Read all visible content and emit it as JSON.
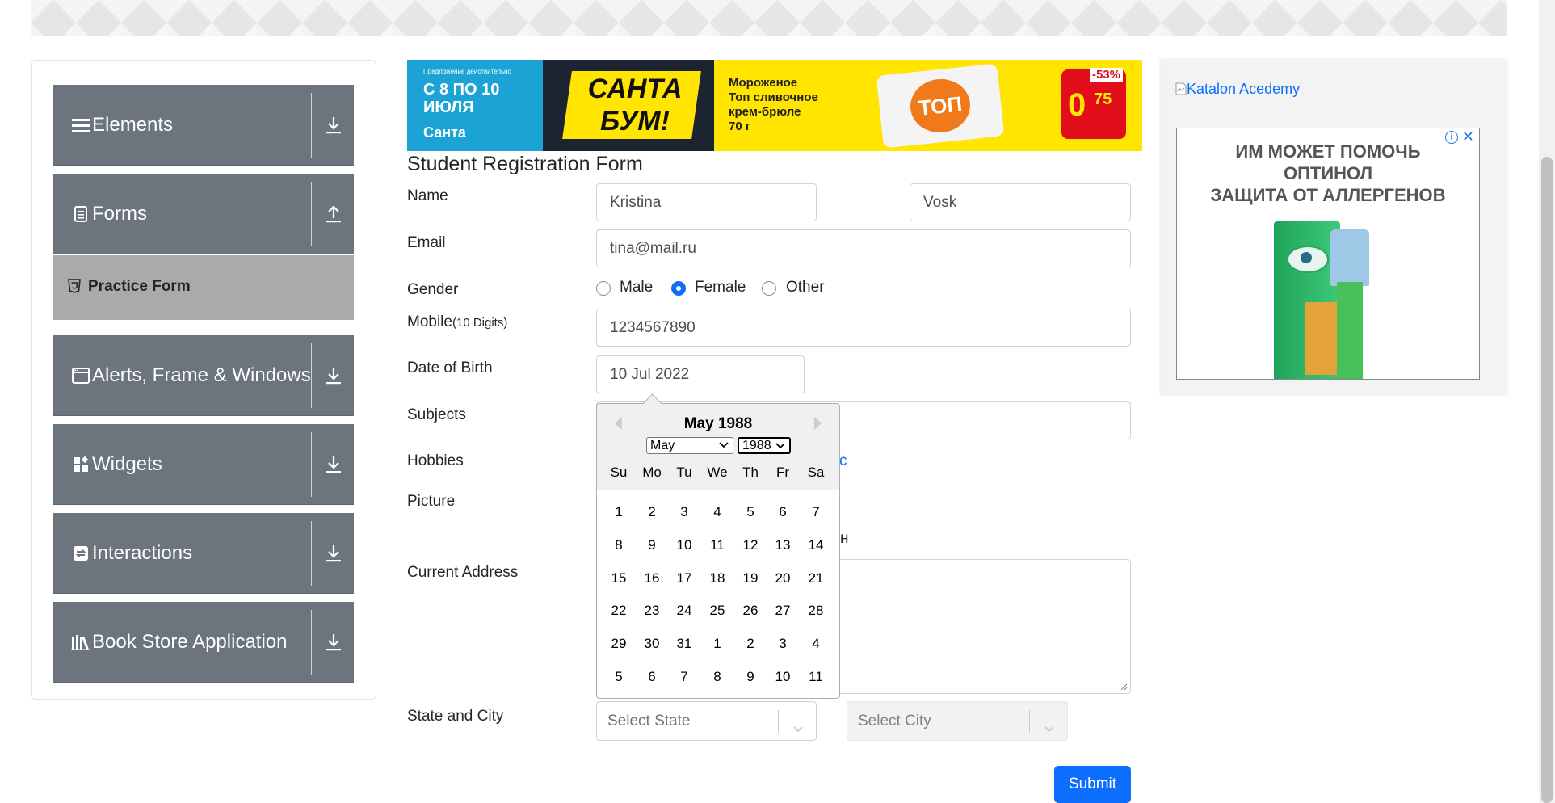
{
  "nav": {
    "groups": [
      {
        "label": "Elements",
        "icon": "hamburger-icon",
        "arrow": "download-arrow-icon"
      },
      {
        "label": "Forms",
        "icon": "document-icon",
        "arrow": "upload-arrow-icon"
      },
      {
        "label": "Alerts, Frame & Windows",
        "icon": "window-icon",
        "arrow": "download-arrow-icon"
      },
      {
        "label": "Widgets",
        "icon": "widgets-icon",
        "arrow": "download-arrow-icon"
      },
      {
        "label": "Interactions",
        "icon": "interactions-icon",
        "arrow": "download-arrow-icon"
      },
      {
        "label": "Book Store Application",
        "icon": "books-icon",
        "arrow": "download-arrow-icon"
      }
    ],
    "active_item": {
      "label": "Practice Form",
      "icon": "html5-icon"
    }
  },
  "ad_banner": {
    "left_text": [
      "Предложение действительно",
      "С 8 ПО 10",
      "ИЮЛЯ",
      "Санта"
    ],
    "brand": "САНТА БУМ!",
    "product_text": [
      "Мороженое",
      "Топ сливочное",
      "крем-брюле",
      "70 г"
    ],
    "product_name": "ТОП",
    "discount": "-53%",
    "price_main": "0",
    "price_cents": "75"
  },
  "form": {
    "title": "Student Registration Form",
    "labels": {
      "name": "Name",
      "email": "Email",
      "gender": "Gender",
      "mobile": "Mobile",
      "mobile_hint": "(10 Digits)",
      "dob": "Date of Birth",
      "subjects": "Subjects",
      "hobbies": "Hobbies",
      "picture": "Picture",
      "address": "Current Address",
      "state_city": "State and City"
    },
    "first_name": "Kristina",
    "last_name": "Vosk",
    "email": "tina@mail.ru",
    "gender_options": [
      "Male",
      "Female",
      "Other"
    ],
    "gender_selected": "Female",
    "mobile": "1234567890",
    "dob": "10 Jul 2022",
    "hobbies_fragment": "c",
    "picture_fragment": "н",
    "state_placeholder": "Select State",
    "city_placeholder": "Select City",
    "submit": "Submit"
  },
  "datepicker": {
    "title": "May 1988",
    "month_select": "May",
    "year_select": "1988",
    "day_names": [
      "Su",
      "Mo",
      "Tu",
      "We",
      "Th",
      "Fr",
      "Sa"
    ],
    "weeks": [
      [
        "1",
        "2",
        "3",
        "4",
        "5",
        "6",
        "7"
      ],
      [
        "8",
        "9",
        "10",
        "11",
        "12",
        "13",
        "14"
      ],
      [
        "15",
        "16",
        "17",
        "18",
        "19",
        "20",
        "21"
      ],
      [
        "22",
        "23",
        "24",
        "25",
        "26",
        "27",
        "28"
      ],
      [
        "29",
        "30",
        "31",
        "1",
        "2",
        "3",
        "4"
      ],
      [
        "5",
        "6",
        "7",
        "8",
        "9",
        "10",
        "11"
      ]
    ]
  },
  "right_ad": {
    "link_text": "Katalon Acedemy",
    "lines": [
      "ИМ МОЖЕТ ПОМОЧЬ",
      "ОПТИНОЛ",
      "ЗАЩИТА ОТ АЛЛЕРГЕНОВ"
    ],
    "info": "i",
    "close": "✕"
  },
  "colors": {
    "nav_bg": "#6c757d",
    "active_bg": "#aaaaaa",
    "primary": "#0d6efd",
    "ad_yellow": "#ffe500",
    "ad_blue": "#1ba3d6"
  }
}
